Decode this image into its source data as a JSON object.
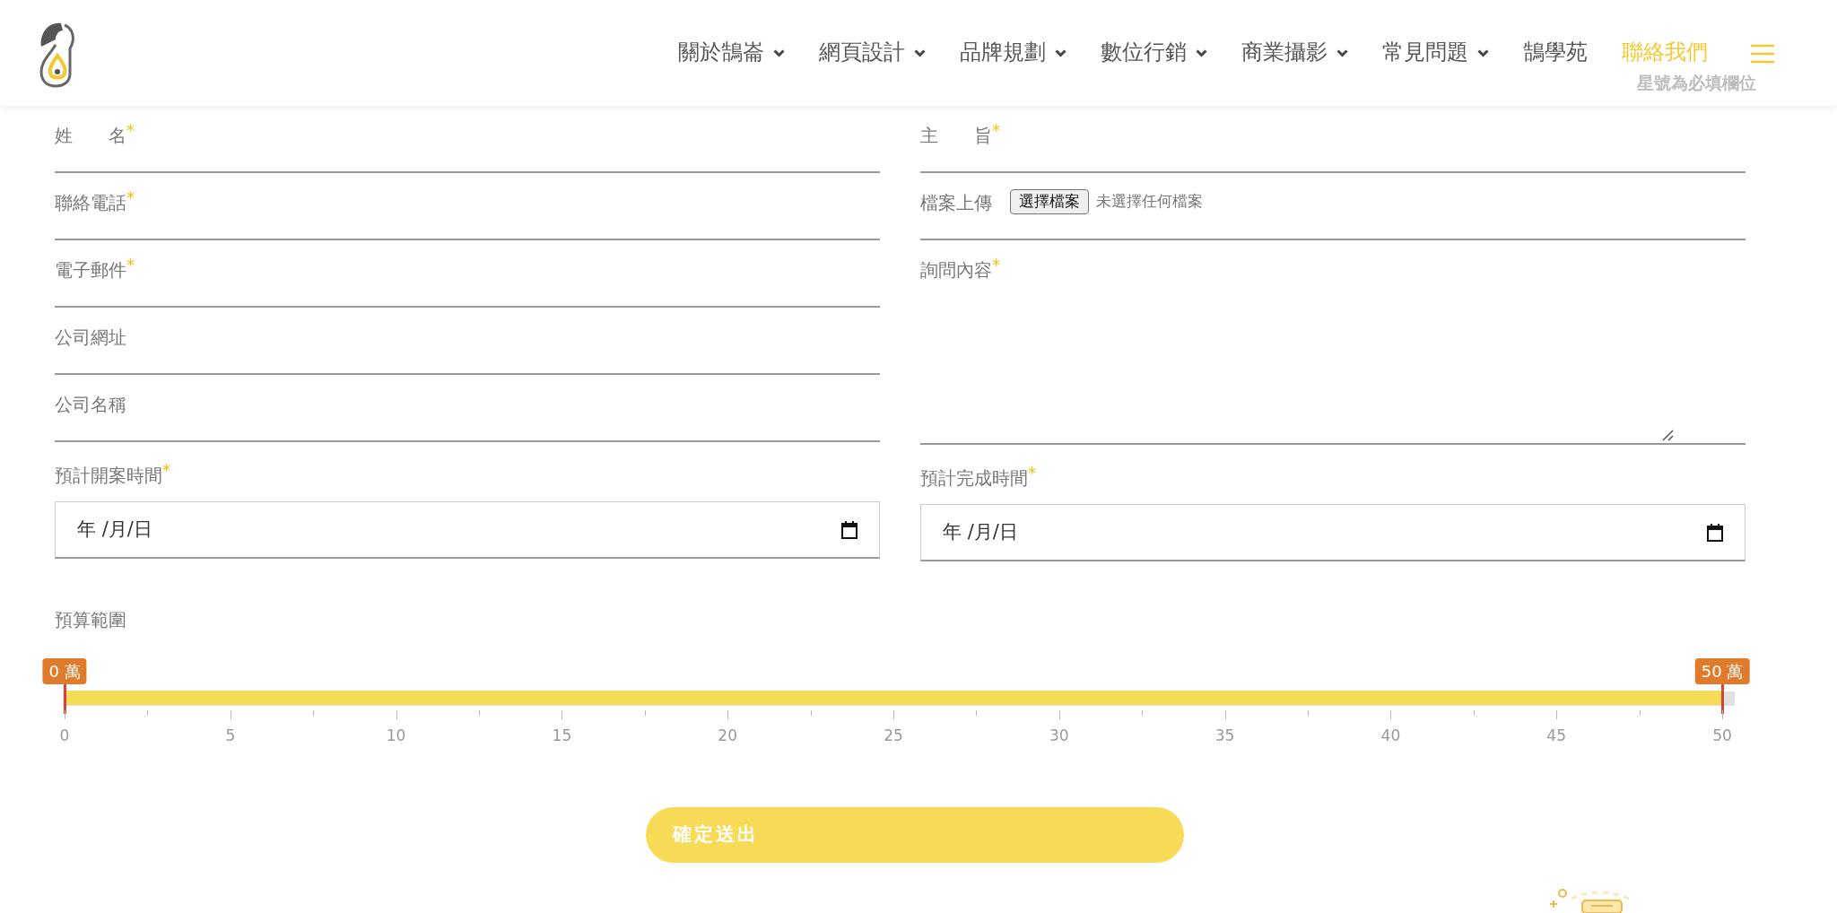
{
  "header": {
    "nav": [
      {
        "label": "關於鵠崙",
        "has_menu": true,
        "selected": false
      },
      {
        "label": "網頁設計",
        "has_menu": true,
        "selected": false
      },
      {
        "label": "品牌規劃",
        "has_menu": true,
        "selected": false
      },
      {
        "label": "數位行銷",
        "has_menu": true,
        "selected": false
      },
      {
        "label": "商業攝影",
        "has_menu": true,
        "selected": false
      },
      {
        "label": "常見問題",
        "has_menu": true,
        "selected": false
      },
      {
        "label": "鵠學苑",
        "has_menu": false,
        "selected": false
      },
      {
        "label": "聯絡我們",
        "has_menu": false,
        "selected": true
      }
    ]
  },
  "form": {
    "note": "星號為必填欄位",
    "left": [
      {
        "kind": "text",
        "label": "姓　　名",
        "required": true
      },
      {
        "kind": "text",
        "label": "聯絡電話",
        "required": true
      },
      {
        "kind": "text",
        "label": "電子郵件",
        "required": true
      },
      {
        "kind": "text",
        "label": "公司網址",
        "required": false
      },
      {
        "kind": "text",
        "label": "公司名稱",
        "required": false
      },
      {
        "kind": "date",
        "label": "預計開案時間",
        "required": true,
        "placeholder": "年 /月/日"
      }
    ],
    "right": [
      {
        "kind": "text",
        "label": "主　　旨",
        "required": true
      },
      {
        "kind": "file",
        "label": "檔案上傳",
        "required": false,
        "button": "選擇檔案",
        "status": "未選擇任何檔案"
      },
      {
        "kind": "textarea",
        "label": "詢問內容",
        "required": true
      },
      {
        "kind": "date",
        "label": "預計完成時間",
        "required": true,
        "placeholder": "年 /月/日"
      }
    ],
    "budget": {
      "label": "預算範圍",
      "handles": [
        {
          "tooltip": "0 萬",
          "level": 0
        },
        {
          "tooltip": "50 萬",
          "level": 1
        }
      ],
      "tick_labels": [
        "0",
        "5",
        "10",
        "15",
        "20",
        "25",
        "30",
        "35",
        "40",
        "45",
        "50"
      ]
    },
    "submit": "確定送出"
  }
}
